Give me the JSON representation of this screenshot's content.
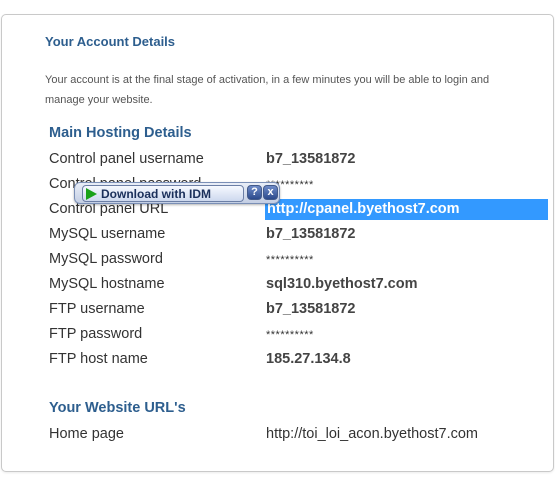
{
  "card": {
    "title": "Your Account Details",
    "intro": "Your account is at the final stage of activation, in a few minutes you will be able to login and manage your website."
  },
  "hosting": {
    "title": "Main Hosting Details",
    "rows": [
      {
        "label": "Control panel username",
        "value": "b7_13581872"
      },
      {
        "label": "Control panel password",
        "value": "**********"
      },
      {
        "label": "Control panel URL",
        "value": "http://cpanel.byethost7.com"
      },
      {
        "label": "MySQL username",
        "value": "b7_13581872"
      },
      {
        "label": "MySQL password",
        "value": "**********"
      },
      {
        "label": "MySQL hostname",
        "value": "sql310.byethost7.com"
      },
      {
        "label": "FTP username",
        "value": "b7_13581872"
      },
      {
        "label": "FTP password",
        "value": "**********"
      },
      {
        "label": "FTP host name",
        "value": "185.27.134.8"
      }
    ]
  },
  "website": {
    "title": "Your Website URL's",
    "rows": [
      {
        "label": "Home page",
        "value": "http://toi_loi_acon.byethost7.com"
      }
    ]
  },
  "idm": {
    "button_label": "Download with IDM",
    "help_label": "?",
    "close_label": "x",
    "icons": {
      "play": "play-icon",
      "help": "help-icon",
      "close": "close-icon"
    },
    "colors": {
      "play": "#19a219",
      "bar": "#c3cee4"
    }
  },
  "colors": {
    "heading": "#2d5e8e",
    "highlight": "#3399ff",
    "text": "#333333"
  }
}
